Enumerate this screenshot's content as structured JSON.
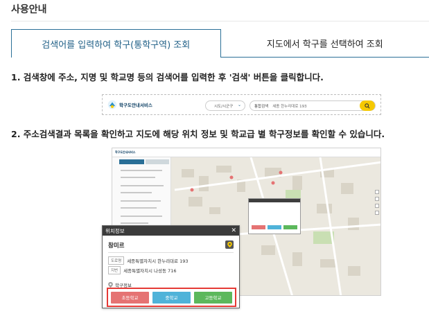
{
  "page": {
    "title": "사용안내"
  },
  "tabs": [
    {
      "label": "검색어를 입력하여 학구(통학구역) 조회",
      "active": true
    },
    {
      "label": "지도에서 학구를 선택하여 조회",
      "active": false
    }
  ],
  "steps": {
    "step1": "1. 검색창에 주소, 지명 및 학교명 등의 검색어를 입력한 후 '검색' 버튼을 클릭합니다.",
    "step2": "2. 주소검색결과 목록을 확인하고 지도에 해당 위치 정보 및 학교급 별 학구정보를 확인할 수 있습니다."
  },
  "search_mock": {
    "service_name": "학구도안내서비스",
    "region_select": "시도/시군구",
    "query_label": "통합검색",
    "query_value": "세종 한누리대로 193"
  },
  "map_mock": {
    "service_name": "학구도안내서비스"
  },
  "location_popup": {
    "header": "위치정보",
    "close_glyph": "✕",
    "place_name": "참미르",
    "road_tag": "도로명",
    "road_address": "세종특별자치시 한누리대로 193",
    "lot_tag": "지번",
    "lot_address": "세종특별자치시 나성동 716",
    "school_info_label": "학구정보",
    "buttons": [
      {
        "label": "초등학교",
        "color": "#e57373"
      },
      {
        "label": "중학교",
        "color": "#4fb3d9"
      },
      {
        "label": "고등학교",
        "color": "#5cb85c"
      }
    ]
  },
  "colors": {
    "accent": "#2a6f97",
    "search_button": "#f6c900",
    "highlight_border": "#e53935"
  },
  "icons": {
    "logo": "school-logo-icon",
    "search": "search-icon",
    "pin": "location-pin-icon",
    "school": "map-marker-icon",
    "close": "close-icon"
  }
}
